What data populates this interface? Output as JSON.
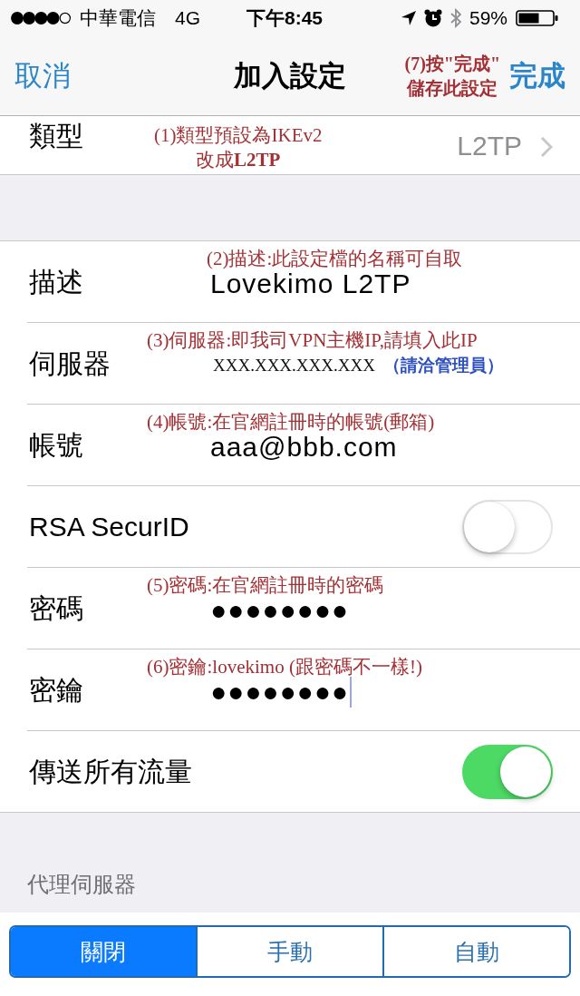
{
  "status_bar": {
    "carrier": "中華電信",
    "network": "4G",
    "time": "下午8:45",
    "battery": "59%"
  },
  "nav": {
    "cancel": "取消",
    "title": "加入設定",
    "note": "(7)按\"完成\"\n儲存此設定",
    "done": "完成"
  },
  "type_row": {
    "label": "類型",
    "note": "(1)類型預設為IKEv2\n改成**L2TP**",
    "value": "L2TP"
  },
  "rows": [
    {
      "kind": "field",
      "label": "描述",
      "note": "(2)描述:此設定檔的名稱可自取",
      "value": "Lovekimo L2TP",
      "focused": false
    },
    {
      "kind": "note_field",
      "label": "伺服器",
      "note": "(3)伺服器:即我司VPN主機IP,請填入此IP",
      "value": "XXX.XXX.XXX.XXX",
      "value_note": "（請洽管理員）",
      "focused": false
    },
    {
      "kind": "field",
      "label": "帳號",
      "note": "(4)帳號:在官網註冊時的帳號(郵箱)",
      "value": "aaa@bbb.com",
      "focused": false
    },
    {
      "kind": "toggle",
      "label": "RSA SecurID",
      "on": false
    },
    {
      "kind": "field",
      "label": "密碼",
      "note": "(5)密碼:在官網註冊時的密碼",
      "value": "●●●●●●●●",
      "focused": false
    },
    {
      "kind": "field",
      "label": "密鑰",
      "note": "(6)密鑰:lovekimo (跟密碼不一樣!)",
      "value": "●●●●●●●●",
      "focused": true
    },
    {
      "kind": "toggle",
      "label": "傳送所有流量",
      "on": true
    }
  ],
  "proxy": {
    "header": "代理伺服器",
    "segments": [
      {
        "label": "關閉",
        "selected": true
      },
      {
        "label": "手動",
        "selected": false
      },
      {
        "label": "自動",
        "selected": false
      }
    ]
  }
}
